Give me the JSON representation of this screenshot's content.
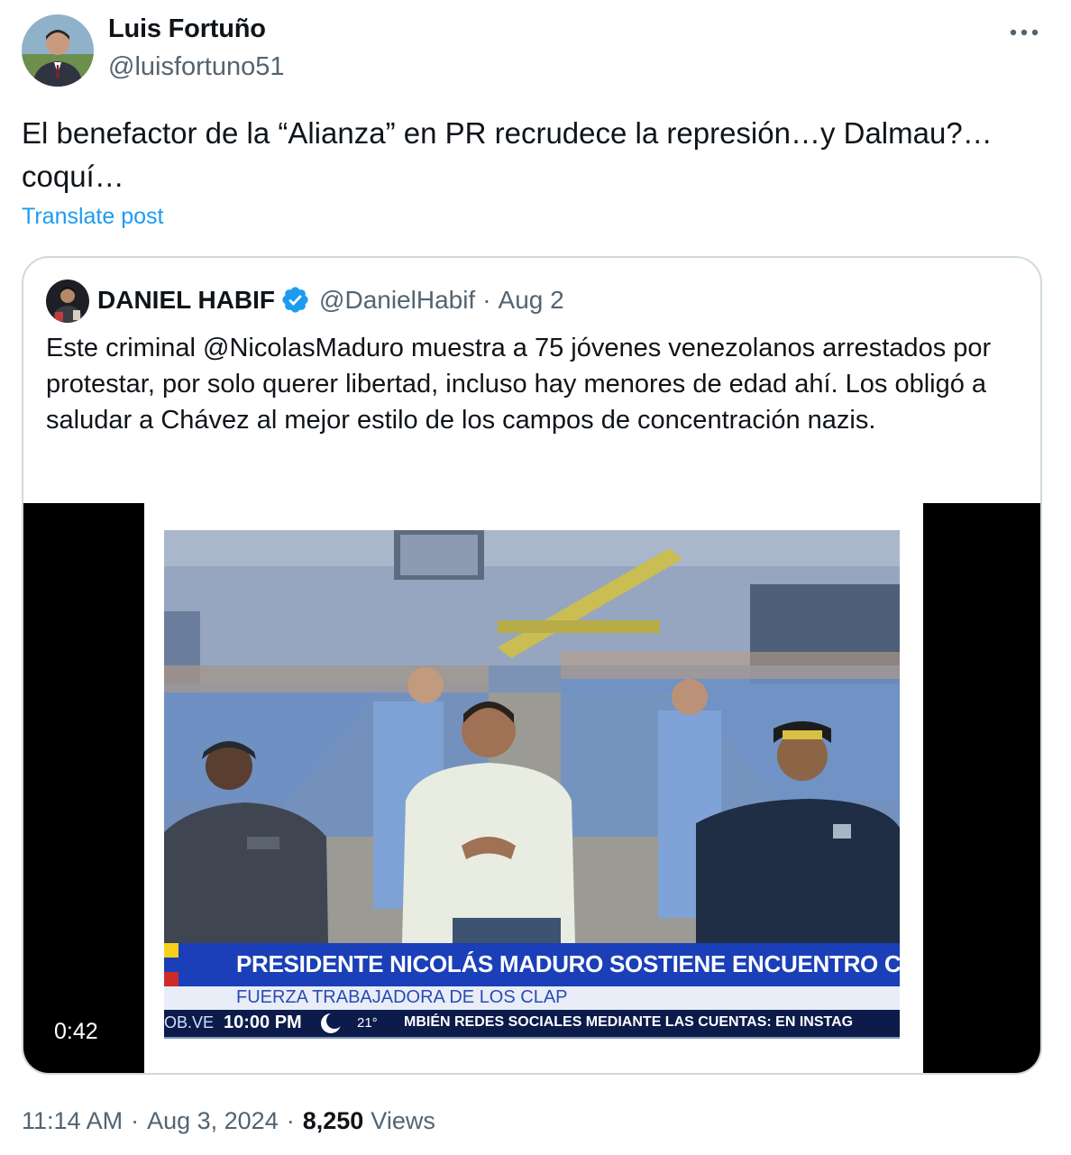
{
  "post": {
    "author_name": "Luis Fortuño",
    "author_handle": "@luisfortuno51",
    "text": "El benefactor de la “Alianza” en PR recrudece la represión…y Dalmau?… coquí…",
    "translate_label": "Translate post",
    "time": "11:14 AM",
    "date": "Aug 3, 2024",
    "views_count": "8,250",
    "views_label": "Views",
    "separator": "·"
  },
  "quote": {
    "author_name": "DANIEL HABIF",
    "author_handle": "@DanielHabif",
    "date": "Aug 2",
    "separator": "·",
    "verified": true,
    "text": "Este criminal @NicolasMaduro muestra a 75 jóvenes venezolanos arrestados por protestar, por solo querer libertad, incluso hay menores de edad ahí. Los obligó a saludar a Chávez al mejor estilo de los campos de concentración nazis.",
    "video": {
      "duration": "0:42",
      "headline": "PRESIDENTE NICOLÁS MADURO SOSTIENE ENCUENTRO CON LA",
      "subheadline": "FUERZA TRABAJADORA DE LOS CLAP",
      "ticker_url": "OB.VE",
      "ticker_time": "10:00 PM",
      "ticker_temp": "21°",
      "ticker_scroll": "MBIÉN REDES SOCIALES MEDIANTE LAS CUENTAS: EN INSTAG"
    }
  },
  "icons": {
    "more": "more-options-icon",
    "verified": "verified-badge-icon",
    "moon": "moon-icon"
  },
  "colors": {
    "link": "#1d9bf0",
    "secondary_text": "#536471",
    "verified": "#1d9bf0",
    "border": "#cfd9de",
    "lower_third_blue": "#1a3fb8"
  }
}
